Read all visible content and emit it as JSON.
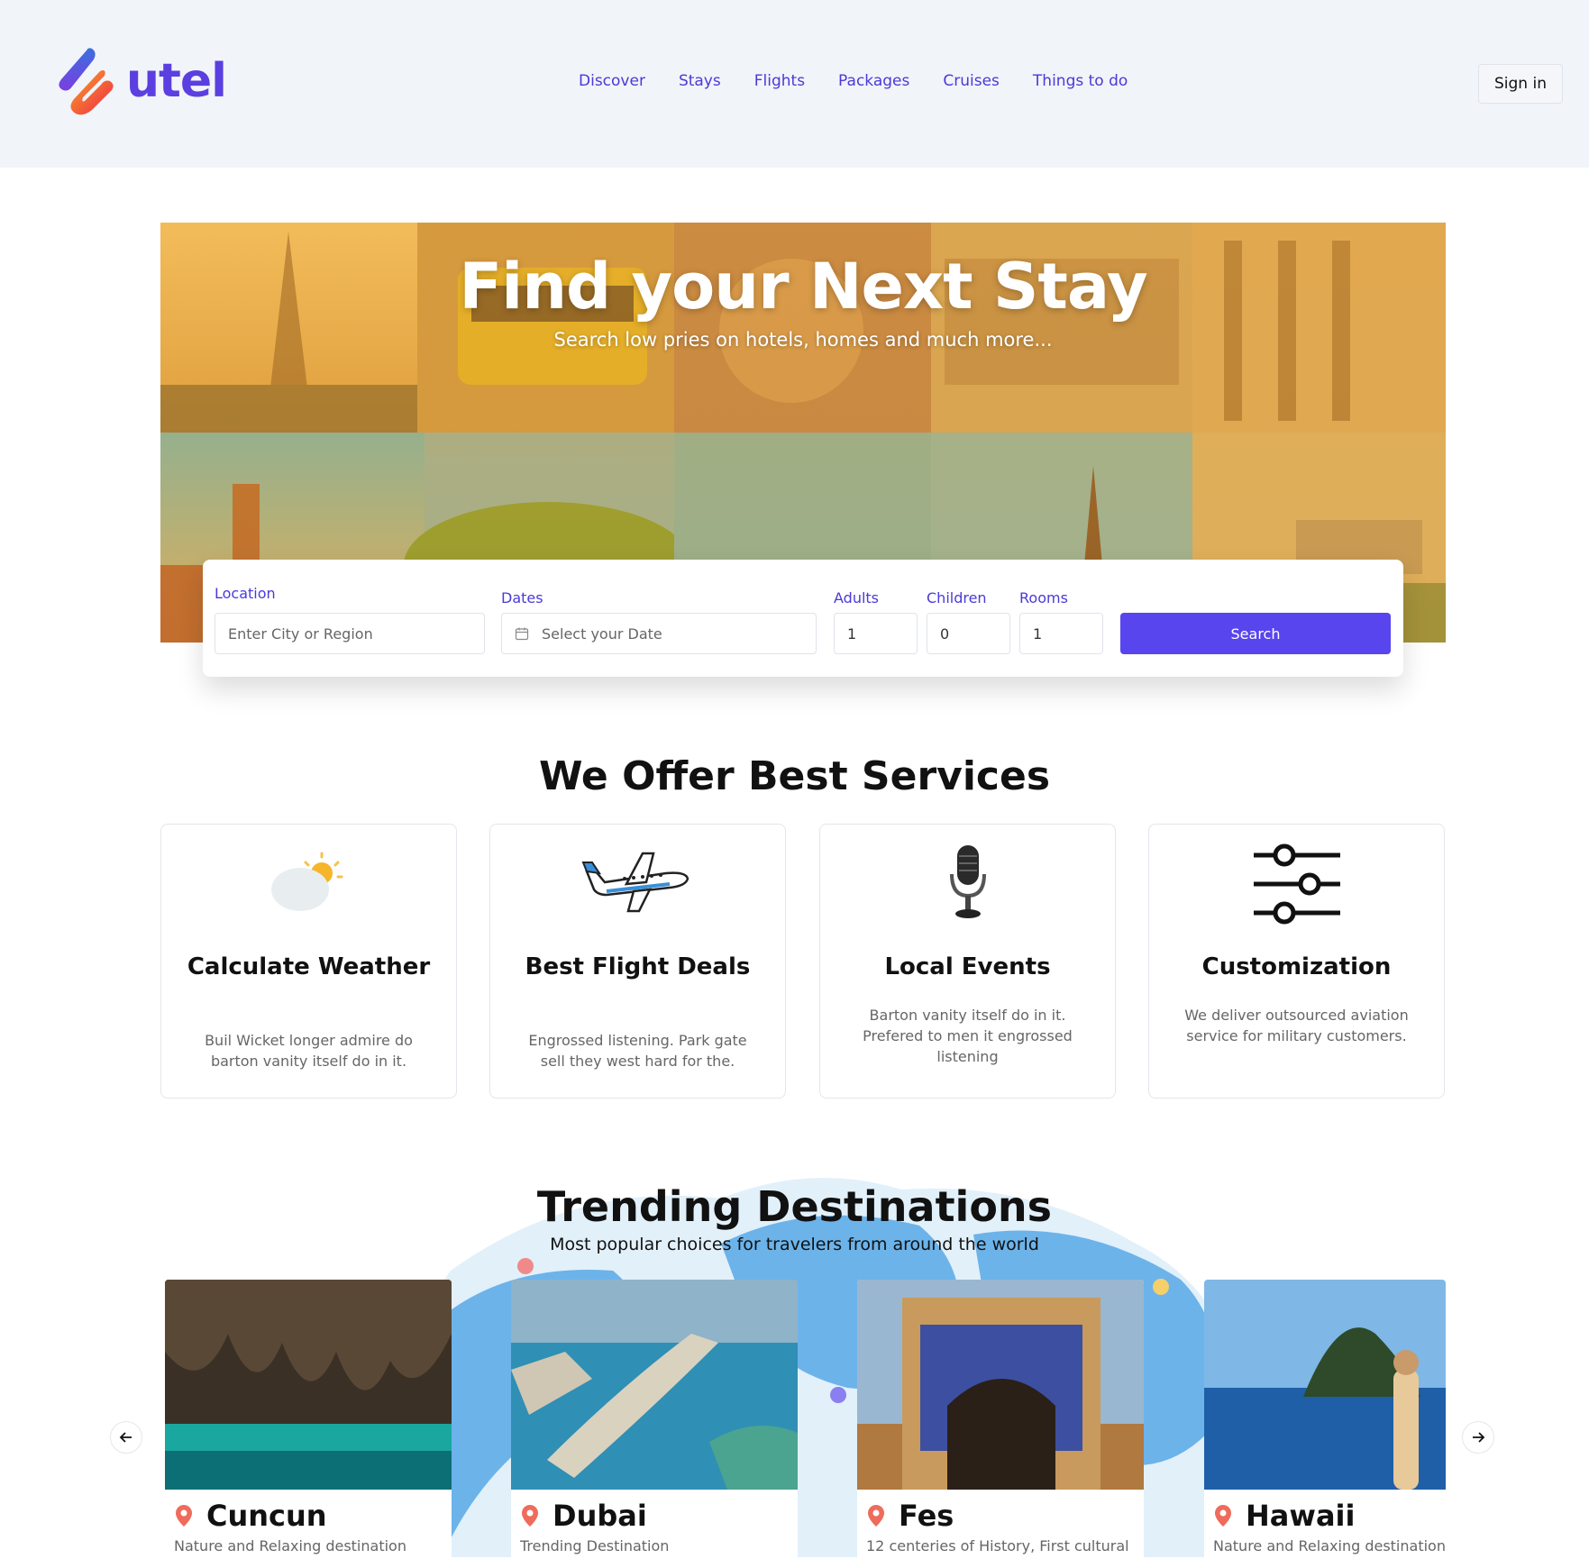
{
  "header": {
    "brand": "utel",
    "nav": [
      "Discover",
      "Stays",
      "Flights",
      "Packages",
      "Cruises",
      "Things to do"
    ],
    "signin_label": "Sign in"
  },
  "hero": {
    "title": "Find your Next Stay",
    "subtitle": "Search low pries on hotels, homes and much more..."
  },
  "search": {
    "location_label": "Location",
    "location_placeholder": "Enter City or Region",
    "dates_label": "Dates",
    "dates_placeholder": "Select your Date",
    "adults_label": "Adults",
    "adults_value": "1",
    "children_label": "Children",
    "children_value": "0",
    "rooms_label": "Rooms",
    "rooms_value": "1",
    "button_label": "Search"
  },
  "services": {
    "title": "We Offer Best Services",
    "cards": [
      {
        "icon": "weather-icon",
        "title": "Calculate Weather",
        "desc": "Buil Wicket longer admire do barton vanity itself do in it."
      },
      {
        "icon": "airplane-icon",
        "title": "Best Flight Deals",
        "desc": "Engrossed listening. Park gate sell they west hard for the."
      },
      {
        "icon": "microphone-icon",
        "title": "Local Events",
        "desc": "Barton vanity itself do in it. Prefered to men it engrossed listening"
      },
      {
        "icon": "sliders-icon",
        "title": "Customization",
        "desc": "We deliver outsourced aviation service for military customers."
      }
    ]
  },
  "trending": {
    "title": "Trending Destinations",
    "subtitle": "Most popular choices for travelers from around the world",
    "destinations": [
      {
        "name": "Cuncun",
        "desc": "Nature and Relaxing destination"
      },
      {
        "name": "Dubai",
        "desc": "Trending Destination"
      },
      {
        "name": "Fes",
        "desc": "12 centeries of History, First cultural"
      },
      {
        "name": "Hawaii",
        "desc": "Nature and Relaxing destination"
      }
    ]
  },
  "colors": {
    "accent": "#5845ee",
    "nav_text": "#4a3ad8",
    "header_bg": "#f1f4f9"
  }
}
